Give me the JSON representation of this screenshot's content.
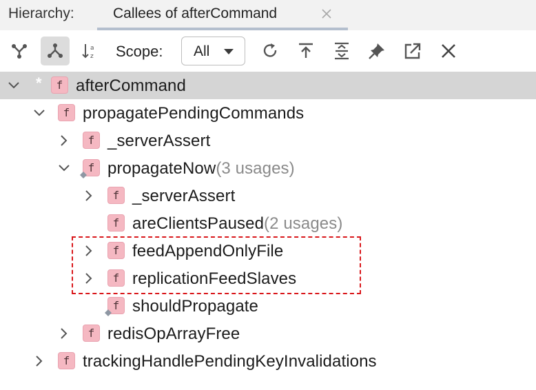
{
  "header": {
    "hierarchy_label": "Hierarchy:",
    "tab_title": "Callees of afterCommand"
  },
  "toolbar": {
    "scope_label": "Scope:",
    "scope_value": "All"
  },
  "tree": {
    "root": {
      "name": "afterCommand",
      "marker": "*"
    },
    "propagatePendingCommands": "propagatePendingCommands",
    "serverAssert1": "_serverAssert",
    "propagateNow": "propagateNow",
    "propagateNow_usage": "(3 usages)",
    "serverAssert2": "_serverAssert",
    "areClientsPaused": "areClientsPaused",
    "areClientsPaused_usage": "(2 usages)",
    "feedAppendOnlyFile": "feedAppendOnlyFile",
    "replicationFeedSlaves": "replicationFeedSlaves",
    "shouldPropagate": "shouldPropagate",
    "redisOpArrayFree": "redisOpArrayFree",
    "trackingHandlePendingKeyInvalidations": "trackingHandlePendingKeyInvalidations"
  },
  "icons": {
    "function_badge": "f"
  },
  "colors": {
    "function_icon_bg": "#f5b8c2",
    "selection": "#d5d5d5",
    "highlight_box": "#d9161a",
    "usage_text": "#8a8a8a"
  }
}
